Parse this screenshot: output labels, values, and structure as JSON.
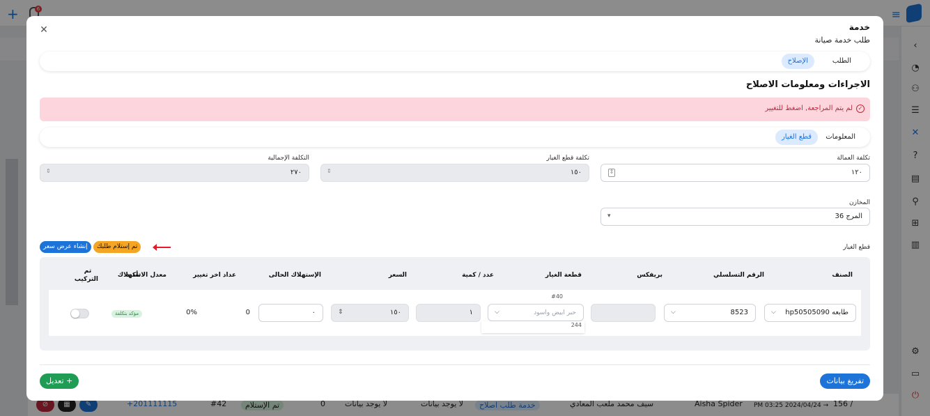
{
  "background": {
    "notif_count": "6",
    "row": {
      "count": "156 /",
      "date1": "PM 03:25 2024/04/24 →",
      "name": "Aisha Spider",
      "customer": "سيف محمد ملعب المعادي",
      "type": "خدمة طلب اصلاح",
      "nodata1": "لا يوجد بيانات",
      "nodata2": "لا يوجد بيانات",
      "zero": "0",
      "status": "تم الإستلام",
      "num": "#42",
      "phone": "+201111115"
    }
  },
  "modal": {
    "title": "خدمة",
    "subtitle": "طلب خدمة صيانة",
    "tabs": [
      {
        "label": "الطلب"
      },
      {
        "label": "الإصلاح"
      }
    ],
    "section_title": "الاجراءات ومعلومات الاصلاح",
    "alert_text": "لم يتم المراجعة, اضغط للتغيير",
    "subtabs": [
      {
        "label": "المعلومات"
      },
      {
        "label": "قطع الغيار"
      }
    ],
    "fields": {
      "labor_cost_label": "تكلفة العمالة",
      "labor_cost_value": "١٢٠",
      "parts_cost_label": "تكلفة قطع الغيار",
      "parts_cost_value": "١٥٠",
      "total_cost_label": "التكلفة الإجمالية",
      "total_cost_value": "٢٧٠",
      "warehouse_label": "المخازن",
      "warehouse_value": "المرج 36"
    },
    "parts_label": "قطع الغيار",
    "buttons": {
      "received": "تم إستلام طلبك",
      "create_quote": "إنشاء عرض سعر",
      "clear": "تفريغ بيانات",
      "edit": "+ تعديل"
    },
    "table": {
      "headers": [
        "الصنف",
        "الرقم التسلسلي",
        "بريفكس",
        "قطعة الغيار",
        "عدد / كمية",
        "السعر",
        "الإستهلاك الحالى",
        "عداد اخر تغيير",
        "معدل الاستهلاك",
        "تأكيد",
        "تم التركيب"
      ],
      "row": {
        "category": "طابعه hp50505090",
        "serial": "8523",
        "prefix": "",
        "part_top": "#40",
        "part_placeholder": "حبر ابيض واسود",
        "part_bottom": "244",
        "quantity": "١",
        "price": "١٥٠",
        "current_usage": "٠",
        "last_counter": "0",
        "usage_rate": "0%",
        "confirm_badge": "مؤكد بتكلفة"
      }
    }
  }
}
